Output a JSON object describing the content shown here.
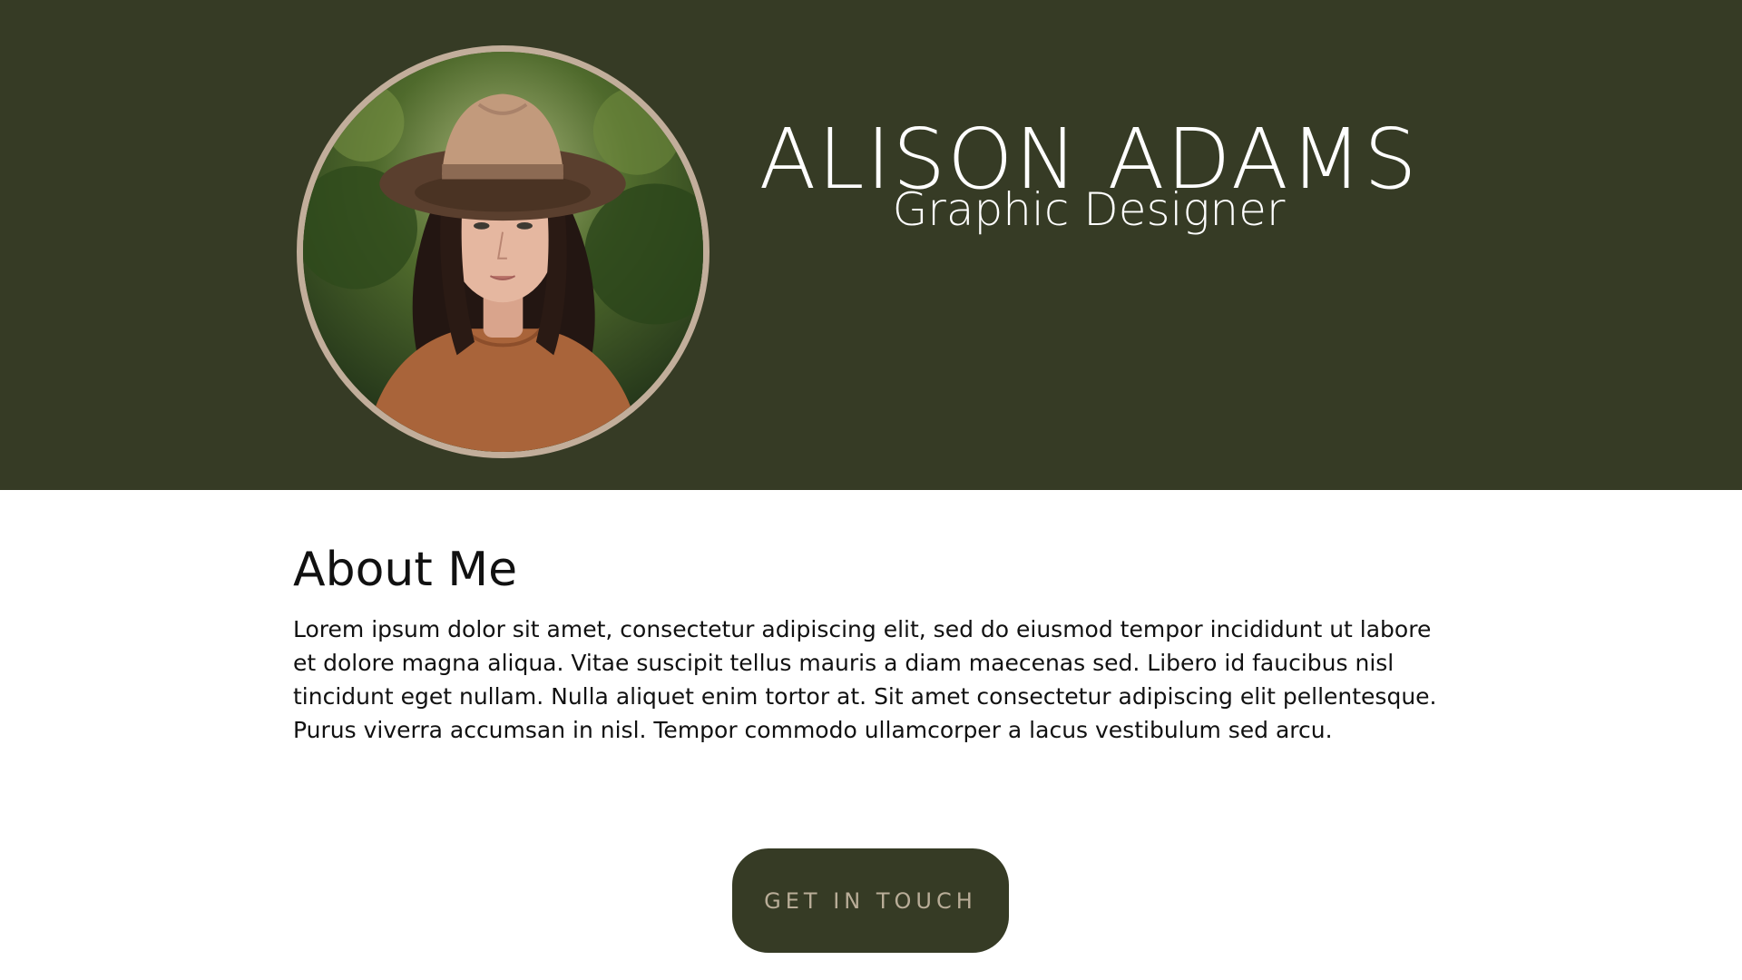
{
  "header": {
    "name": "ALISON ADAMS",
    "role": "Graphic Designer",
    "background_color": "#363b25"
  },
  "portrait": {
    "icon": "profile-photo",
    "ring_color": "#c2ae9b"
  },
  "about": {
    "title": "About Me",
    "body": "Lorem ipsum dolor sit amet, consectetur adipiscing elit, sed do eiusmod tempor incididunt ut labore et dolore magna aliqua. Vitae suscipit tellus mauris a diam maecenas sed. Libero id faucibus nisl tincidunt eget nullam. Nulla aliquet enim tortor at. Sit amet consectetur adipiscing elit pellentesque. Purus viverra accumsan in nisl. Tempor commodo ullamcorper a lacus vestibulum sed arcu."
  },
  "cta": {
    "label": "GET IN TOUCH",
    "background_color": "#363b25",
    "text_color": "#b9ad98"
  }
}
